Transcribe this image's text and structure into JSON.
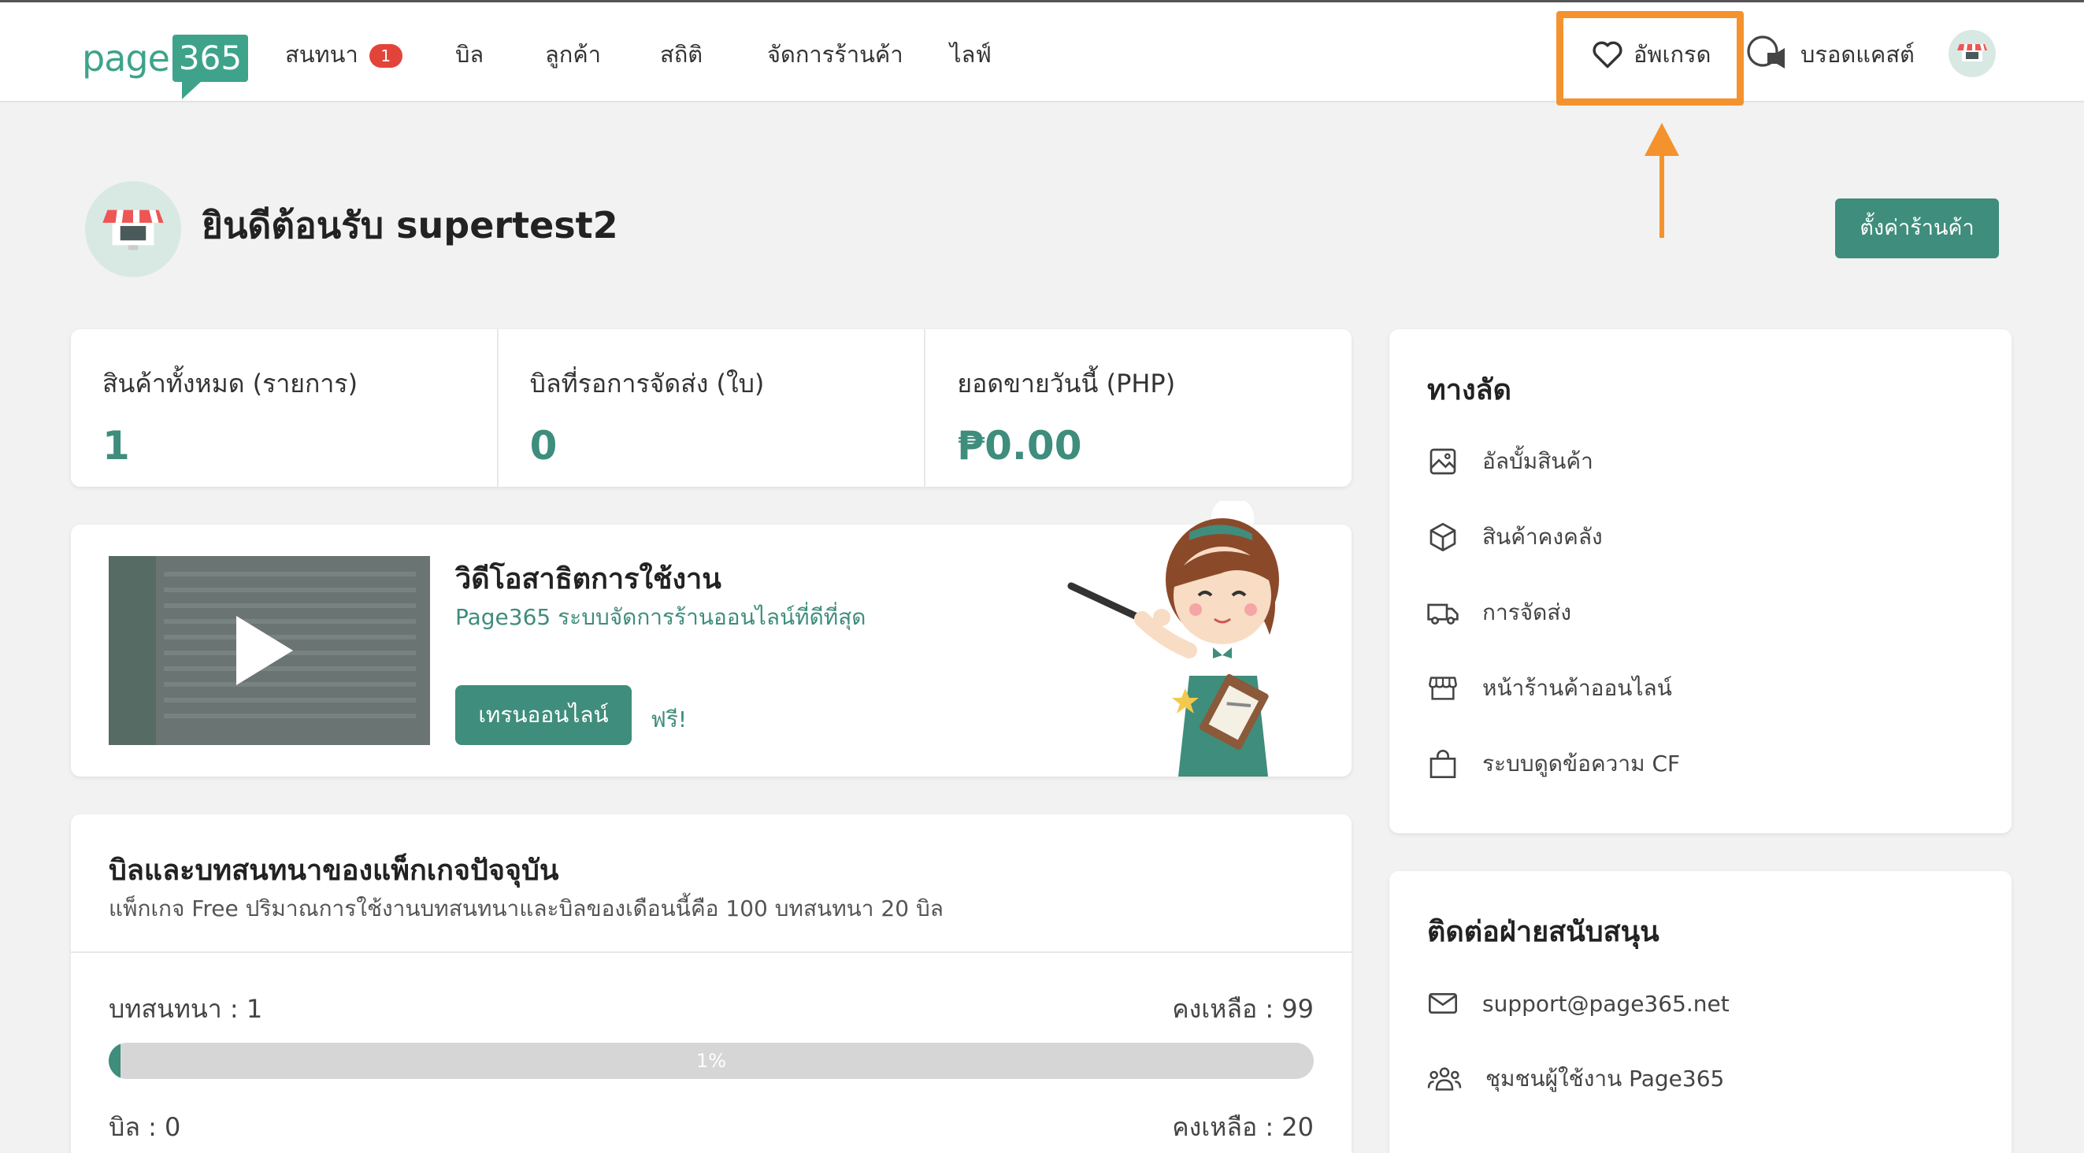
{
  "nav": {
    "logo_text": "page",
    "logo_num": "365",
    "items": [
      {
        "label": "สนทนา",
        "badge": "1"
      },
      {
        "label": "บิล"
      },
      {
        "label": "ลูกค้า"
      },
      {
        "label": "สถิติ"
      },
      {
        "label": "จัดการร้านค้า"
      },
      {
        "label": "ไลฟ์"
      }
    ],
    "upgrade_label": "อัพเกรด",
    "broadcast_label": "บรอดแคสต์",
    "highlight_color": "#f4922e"
  },
  "header": {
    "welcome": "ยินดีต้อนรับ supertest2",
    "settings_button": "ตั้งค่าร้านค้า"
  },
  "stats": [
    {
      "label": "สินค้าทั้งหมด (รายการ)",
      "value": "1"
    },
    {
      "label": "บิลที่รอการจัดส่ง (ใบ)",
      "value": "0"
    },
    {
      "label": "ยอดขายวันนี้ (PHP)",
      "value": "₱0.00"
    }
  ],
  "video": {
    "title": "วิดีโอสาธิตการใช้งาน",
    "subtitle": "Page365 ระบบจัดการร้านออนไลน์ที่ดีที่สุด",
    "button": "เทรนออนไลน์",
    "free": "ฟรี!"
  },
  "package": {
    "title": "บิลและบทสนทนาของแพ็กเกจปัจจุบัน",
    "subtitle": "แพ็กเกจ Free ปริมาณการใช้งานบทสนทนาและบิลของเดือนนี้คือ 100 บทสนทนา 20 บิล",
    "chat_used": "บทสนทนา : 1",
    "chat_remaining": "คงเหลือ : 99",
    "chat_progress_text": "1%",
    "chat_progress": 0.01,
    "bill_used": "บิล : 0",
    "bill_remaining": "คงเหลือ : 20"
  },
  "shortcuts": {
    "title": "ทางลัด",
    "items": [
      {
        "label": "อัลบั้มสินค้า",
        "icon": "image-icon"
      },
      {
        "label": "สินค้าคงคลัง",
        "icon": "box-icon"
      },
      {
        "label": "การจัดส่ง",
        "icon": "truck-icon"
      },
      {
        "label": "หน้าร้านค้าออนไลน์",
        "icon": "storefront-icon"
      },
      {
        "label": "ระบบดูดข้อความ CF",
        "icon": "bag-icon"
      }
    ]
  },
  "support": {
    "title": "ติดต่อฝ่ายสนับสนุน",
    "items": [
      {
        "label": "support@page365.net",
        "icon": "mail-icon"
      },
      {
        "label": "ชุมชนผู้ใช้งาน Page365",
        "icon": "community-icon"
      }
    ]
  },
  "colors": {
    "primary": "#3f8d7c",
    "badge": "#e2443a",
    "background": "#f2f2f2"
  }
}
